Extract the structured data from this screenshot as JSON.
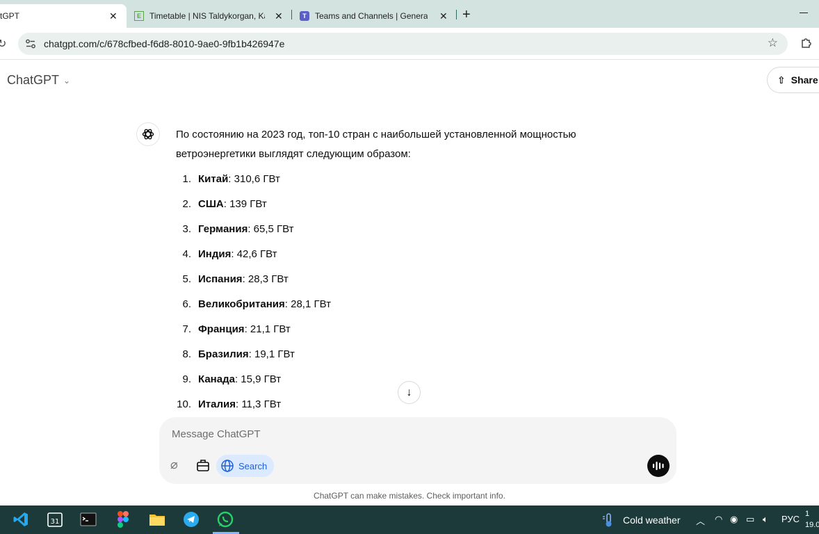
{
  "browser": {
    "tabs": [
      {
        "title": "ChatGPT",
        "visible_title": "tGPT",
        "active": true
      },
      {
        "title": "Timetable | NIS Taldykorgan, Ka",
        "active": false
      },
      {
        "title": "Teams and Channels | General |",
        "active": false
      }
    ],
    "url": "chatgpt.com/c/678cfbed-f6d8-8010-9ae0-9fb1b426947e"
  },
  "app": {
    "title": "ChatGPT",
    "share_label": "Share"
  },
  "message": {
    "intro": "По состоянию на 2023 год, топ-10 стран с наибольшей установленной мощностью ветроэнергетики выглядят следующим образом:",
    "items": [
      {
        "num": "1.",
        "country": "Китай",
        "value": ": 310,6 ГВт"
      },
      {
        "num": "2.",
        "country": "США",
        "value": ": 139 ГВт"
      },
      {
        "num": "3.",
        "country": "Германия",
        "value": ": 65,5 ГВт"
      },
      {
        "num": "4.",
        "country": "Индия",
        "value": ": 42,6 ГВт"
      },
      {
        "num": "5.",
        "country": "Испания",
        "value": ": 28,3 ГВт"
      },
      {
        "num": "6.",
        "country": "Великобритания",
        "value": ": 28,1 ГВт"
      },
      {
        "num": "7.",
        "country": "Франция",
        "value": ": 21,1 ГВт"
      },
      {
        "num": "8.",
        "country": "Бразилия",
        "value": ": 19,1 ГВт"
      },
      {
        "num": "9.",
        "country": "Канада",
        "value": ": 15,9 ГВт"
      },
      {
        "num": "10.",
        "country": "Италия",
        "value": ": 11,3 ГВт"
      }
    ]
  },
  "composer": {
    "placeholder": "Message ChatGPT",
    "search_label": "Search"
  },
  "disclaimer": "ChatGPT can make mistakes. Check important info.",
  "taskbar": {
    "apps": [
      "vscode-icon",
      "calendar-icon",
      "terminal-icon",
      "figma-icon",
      "file-explorer-icon",
      "telegram-icon",
      "whatsapp-icon"
    ],
    "calendar_day": "31",
    "weather": "Cold weather",
    "language": "РУС",
    "clock_time": "1",
    "clock_date": "19.0"
  }
}
